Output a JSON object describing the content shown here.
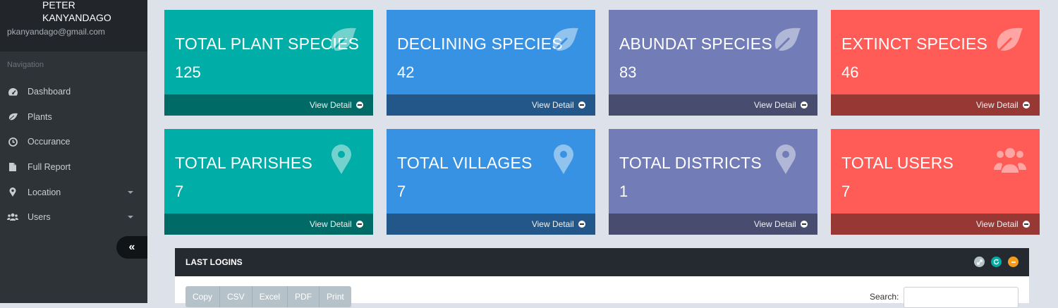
{
  "sidebar": {
    "user_name_line1": "PETER",
    "user_name_line2": "KANYANDAGO",
    "user_email": "pkanyandago@gmail.com",
    "nav_heading": "Navigation",
    "items": [
      {
        "label": "Dashboard",
        "icon": "dashboard-icon"
      },
      {
        "label": "Plants",
        "icon": "leaf-icon"
      },
      {
        "label": "Occurance",
        "icon": "clock-icon"
      },
      {
        "label": "Full Report",
        "icon": "file-icon"
      },
      {
        "label": "Location",
        "icon": "map-marker-icon",
        "has_caret": true
      },
      {
        "label": "Users",
        "icon": "users-icon",
        "has_caret": true
      }
    ],
    "collapse_label": "«"
  },
  "tiles": [
    {
      "title": "TOTAL PLANT SPECIES",
      "value": "125",
      "footer": "View Detail",
      "icon": "leaf-icon",
      "color": "teal"
    },
    {
      "title": "DECLINING SPECIES",
      "value": "42",
      "footer": "View Detail",
      "icon": "leaf-icon",
      "color": "blue"
    },
    {
      "title": "ABUNDAT SPECIES",
      "value": "83",
      "footer": "View Detail",
      "icon": "leaf-icon",
      "color": "purple"
    },
    {
      "title": "EXTINCT SPECIES",
      "value": "46",
      "footer": "View Detail",
      "icon": "leaf-icon",
      "color": "red"
    },
    {
      "title": "TOTAL PARISHES",
      "value": "7",
      "footer": "View Detail",
      "icon": "map-marker-icon",
      "color": "teal"
    },
    {
      "title": "TOTAL VILLAGES",
      "value": "7",
      "footer": "View Detail",
      "icon": "map-marker-icon",
      "color": "blue"
    },
    {
      "title": "TOTAL DISTRICTS",
      "value": "1",
      "footer": "View Detail",
      "icon": "map-marker-icon",
      "color": "purple"
    },
    {
      "title": "TOTAL USERS",
      "value": "7",
      "footer": "View Detail",
      "icon": "users-icon",
      "color": "red"
    }
  ],
  "colors": {
    "teal": "#00ada7",
    "blue": "#3792e3",
    "purple": "#727cb6",
    "red": "#ff5b57",
    "sidebar": "#2e3338"
  },
  "panel": {
    "title": "LAST LOGINS",
    "export_buttons": [
      "Copy",
      "CSV",
      "Excel",
      "PDF",
      "Print"
    ],
    "search_label": "Search:",
    "search_value": ""
  }
}
